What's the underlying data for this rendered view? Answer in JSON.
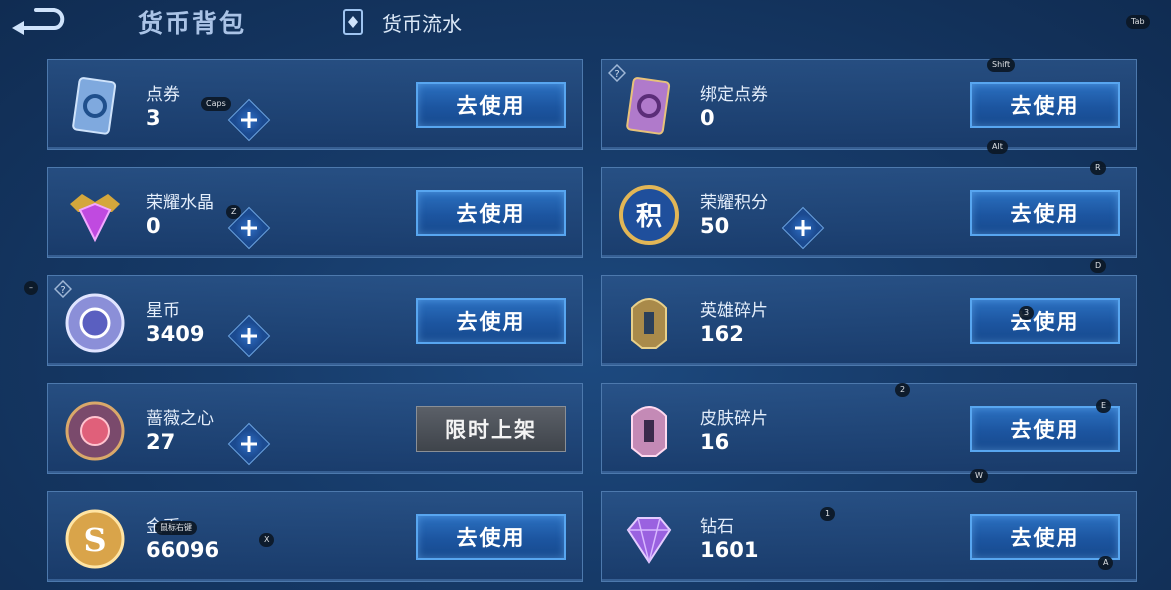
{
  "header": {
    "title": "货币背包",
    "flow_label": "货币流水"
  },
  "action_label": "去使用",
  "limited_label": "限时上架",
  "left_items": [
    {
      "name": "点券",
      "count": "3",
      "button": "去使用"
    },
    {
      "name": "荣耀水晶",
      "count": "0",
      "button": "去使用"
    },
    {
      "name": "星币",
      "count": "3409",
      "button": "去使用"
    },
    {
      "name": "蔷薇之心",
      "count": "27",
      "button": "限时上架"
    },
    {
      "name": "金币",
      "count": "66096",
      "button": "去使用"
    }
  ],
  "right_items": [
    {
      "name": "绑定点券",
      "count": "0",
      "button": "去使用"
    },
    {
      "name": "荣耀积分",
      "count": "50",
      "button": "去使用"
    },
    {
      "name": "英雄碎片",
      "count": "162",
      "button": "去使用"
    },
    {
      "name": "皮肤碎片",
      "count": "16",
      "button": "去使用"
    },
    {
      "name": "钻石",
      "count": "1601",
      "button": "去使用"
    }
  ],
  "key_hints": {
    "tab": "Tab",
    "caps": "Caps",
    "shift": "Shift",
    "alt": "Alt",
    "r": "R",
    "z": "Z",
    "d": "D",
    "minus": "–",
    "three": "3",
    "two": "2",
    "e": "E",
    "w": "W",
    "one": "1",
    "x": "X",
    "a": "A",
    "mouse": "鼠标右键"
  },
  "colors": {
    "accent": "#58a6f0",
    "card_border": "#4d79ad",
    "background": "#163a68"
  }
}
